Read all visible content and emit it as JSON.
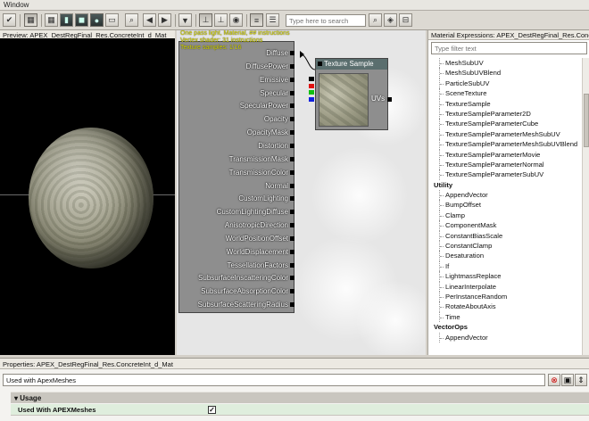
{
  "window": {
    "menu_label": "Window"
  },
  "toolbar": {
    "search_placeholder": "Type here to search",
    "icons": [
      "apply-icon",
      "grid-icon",
      "cylinder-icon",
      "cube-icon",
      "sphere-icon",
      "plane-icon",
      "zoom-icon",
      "back-arrow-icon",
      "forward-arrow-icon",
      "clean-icon",
      "move-icon",
      "connector-icon",
      "eye-icon",
      "list-icon",
      "expression-list-icon",
      "search-icon",
      "palette-icon",
      "hide-icon"
    ]
  },
  "preview": {
    "title": "Preview: APEX_DestRegFinal_Res.ConcreteInt_d_Mat",
    "axis_x": "x",
    "axis_y": "y"
  },
  "graph": {
    "stats": [
      "One pass light, Material, ## instructions",
      "Vertex shader: 31 instructions",
      "Texture samples: 1/16"
    ],
    "main_pins": [
      "Diffuse",
      "DiffusePower",
      "Emissive",
      "Specular",
      "SpecularPower",
      "Opacity",
      "OpacityMask",
      "Distortion",
      "TransmissionMask",
      "TransmissionColor",
      "Normal",
      "CustomLighting",
      "CustomLightingDiffuse",
      "AnisotropicDirection",
      "WorldPositionOffset",
      "WorldDisplacement",
      "TessellationFactors",
      "SubsurfaceInscatteringColor",
      "SubsurfaceAbsorptionColor",
      "SubsurfaceScatteringRadius"
    ],
    "texture_node": {
      "title": "Texture Sample",
      "uv_label": "UVs"
    },
    "rgb_pin_colors": [
      "#000000",
      "#e01010",
      "#10c010",
      "#1020e0",
      "#e8e8e8"
    ]
  },
  "expressions": {
    "title": "Material Expressions: APEX_DestRegFinal_Res.Concre...",
    "filter_placeholder": "Type filter text",
    "rows": [
      {
        "type": "item",
        "label": "MeshSubUV"
      },
      {
        "type": "item",
        "label": "MeshSubUVBlend"
      },
      {
        "type": "item",
        "label": "ParticleSubUV"
      },
      {
        "type": "item",
        "label": "SceneTexture"
      },
      {
        "type": "item",
        "label": "TextureSample"
      },
      {
        "type": "item",
        "label": "TextureSampleParameter2D"
      },
      {
        "type": "item",
        "label": "TextureSampleParameterCube"
      },
      {
        "type": "item",
        "label": "TextureSampleParameterMeshSubUV"
      },
      {
        "type": "item",
        "label": "TextureSampleParameterMeshSubUVBlend"
      },
      {
        "type": "item",
        "label": "TextureSampleParameterMovie"
      },
      {
        "type": "item",
        "label": "TextureSampleParameterNormal"
      },
      {
        "type": "item",
        "label": "TextureSampleParameterSubUV"
      },
      {
        "type": "cat",
        "label": "Utility"
      },
      {
        "type": "item",
        "label": "AppendVector"
      },
      {
        "type": "item",
        "label": "BumpOffset"
      },
      {
        "type": "item",
        "label": "Clamp"
      },
      {
        "type": "item",
        "label": "ComponentMask"
      },
      {
        "type": "item",
        "label": "ConstantBiasScale"
      },
      {
        "type": "item",
        "label": "ConstantClamp"
      },
      {
        "type": "item",
        "label": "Desaturation"
      },
      {
        "type": "item",
        "label": "If"
      },
      {
        "type": "item",
        "label": "LightmassReplace"
      },
      {
        "type": "item",
        "label": "LinearInterpolate"
      },
      {
        "type": "item",
        "label": "PerInstanceRandom"
      },
      {
        "type": "item",
        "label": "RotateAboutAxis"
      },
      {
        "type": "item",
        "label": "Time"
      },
      {
        "type": "cat",
        "label": "VectorOps"
      },
      {
        "type": "item",
        "label": "AppendVector"
      }
    ]
  },
  "properties": {
    "title": "Properties: APEX_DestRegFinal_Res.ConcreteInt_d_Mat",
    "filter_value": "Used with ApexMeshes",
    "category": "Usage",
    "prop_label": "Used With APEXMeshes",
    "checked_mark": "✓"
  },
  "colors": {
    "graph_bg": "#e6e6e6",
    "node_bg": "#8e8e8e",
    "stats_text": "#d8d800",
    "row_highlight": "#dfeedd"
  }
}
